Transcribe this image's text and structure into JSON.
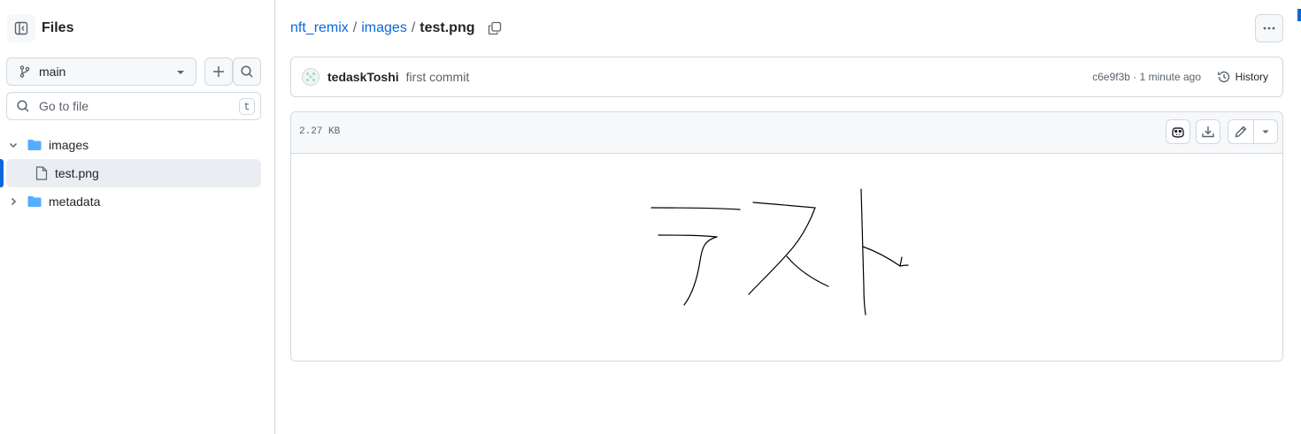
{
  "sidebar": {
    "title": "Files",
    "branch": "main",
    "goto_placeholder": "Go to file",
    "goto_shortcut": "t",
    "tree": [
      {
        "label": "images",
        "type": "folder",
        "expanded": true
      },
      {
        "label": "test.png",
        "type": "file",
        "selected": true
      },
      {
        "label": "metadata",
        "type": "folder",
        "expanded": false
      }
    ]
  },
  "breadcrumb": {
    "repo": "nft_remix",
    "folder": "images",
    "file": "test.png",
    "separator": "/"
  },
  "commit": {
    "author": "tedaskToshi",
    "message": "first commit",
    "sha_time": "c6e9f3b · 1 minute ago",
    "history_label": "History"
  },
  "file": {
    "size": "2.27 KB"
  },
  "colors": {
    "accent": "#0969da",
    "border": "#d1d9e0",
    "folder": "#54aeff"
  }
}
